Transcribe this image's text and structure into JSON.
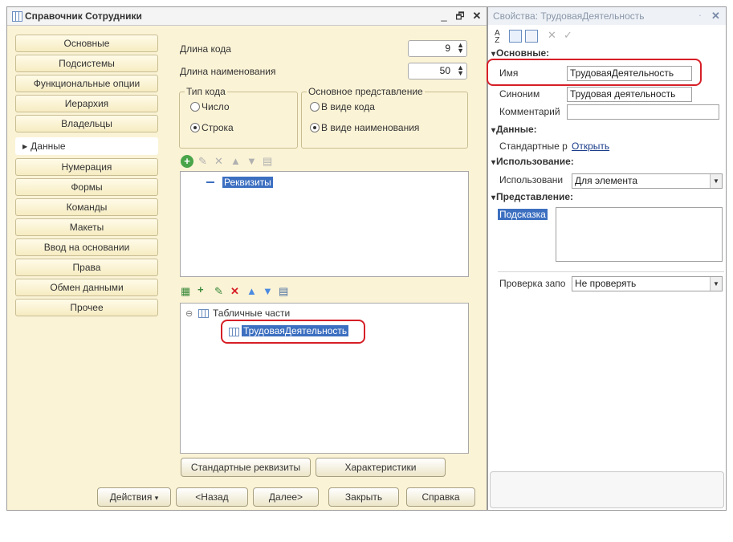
{
  "window": {
    "title": "Справочник Сотрудники",
    "controls": {
      "minimize": "_",
      "restore": "🗗",
      "close": "✕"
    }
  },
  "nav": {
    "items": [
      {
        "label": "Основные"
      },
      {
        "label": "Подсистемы"
      },
      {
        "label": "Функциональные опции"
      },
      {
        "label": "Иерархия"
      },
      {
        "label": "Владельцы"
      },
      {
        "label": "Данные",
        "active": true
      },
      {
        "label": "Нумерация"
      },
      {
        "label": "Формы"
      },
      {
        "label": "Команды"
      },
      {
        "label": "Макеты"
      },
      {
        "label": "Ввод на основании"
      },
      {
        "label": "Права"
      },
      {
        "label": "Обмен данными"
      },
      {
        "label": "Прочее"
      }
    ]
  },
  "fields": {
    "code_length_label": "Длина кода",
    "code_length_value": "9",
    "name_length_label": "Длина наименования",
    "name_length_value": "50",
    "code_type": {
      "legend": "Тип кода",
      "number": "Число",
      "string": "Строка",
      "selected": "string"
    },
    "main_repr": {
      "legend": "Основное представление",
      "as_code": "В виде кода",
      "as_name": "В виде наименования",
      "selected": "as_name"
    }
  },
  "attributes": {
    "root": "Реквизиты"
  },
  "tabular": {
    "root": "Табличные части",
    "item": "ТрудоваяДеятельность"
  },
  "buttons": {
    "standard_attrs": "Стандартные реквизиты",
    "characteristics": "Характеристики",
    "actions": "Действия",
    "back": "<Назад",
    "next": "Далее>",
    "close": "Закрыть",
    "help": "Справка"
  },
  "props": {
    "title": "Свойства: ТрудоваяДеятельность",
    "pin": "ᐧ",
    "close": "✕",
    "sections": {
      "basic": "Основные:",
      "data": "Данные:",
      "usage": "Использование:",
      "presentation": "Представление:"
    },
    "name_label": "Имя",
    "name_value": "ТрудоваяДеятельность",
    "synonym_label": "Синоним",
    "synonym_value": "Трудовая деятельность",
    "comment_label": "Комментарий",
    "comment_value": "",
    "std_attrs_label": "Стандартные р",
    "std_attrs_link": "Открыть",
    "usage_label": "Использовани",
    "usage_value": "Для элемента",
    "hint_label": "Подсказка",
    "check_label": "Проверка запо",
    "check_value": "Не проверять"
  },
  "colors": {
    "window_bg": "#fbf3d6",
    "selection": "#3c6fc0",
    "highlight": "#d61f27"
  }
}
